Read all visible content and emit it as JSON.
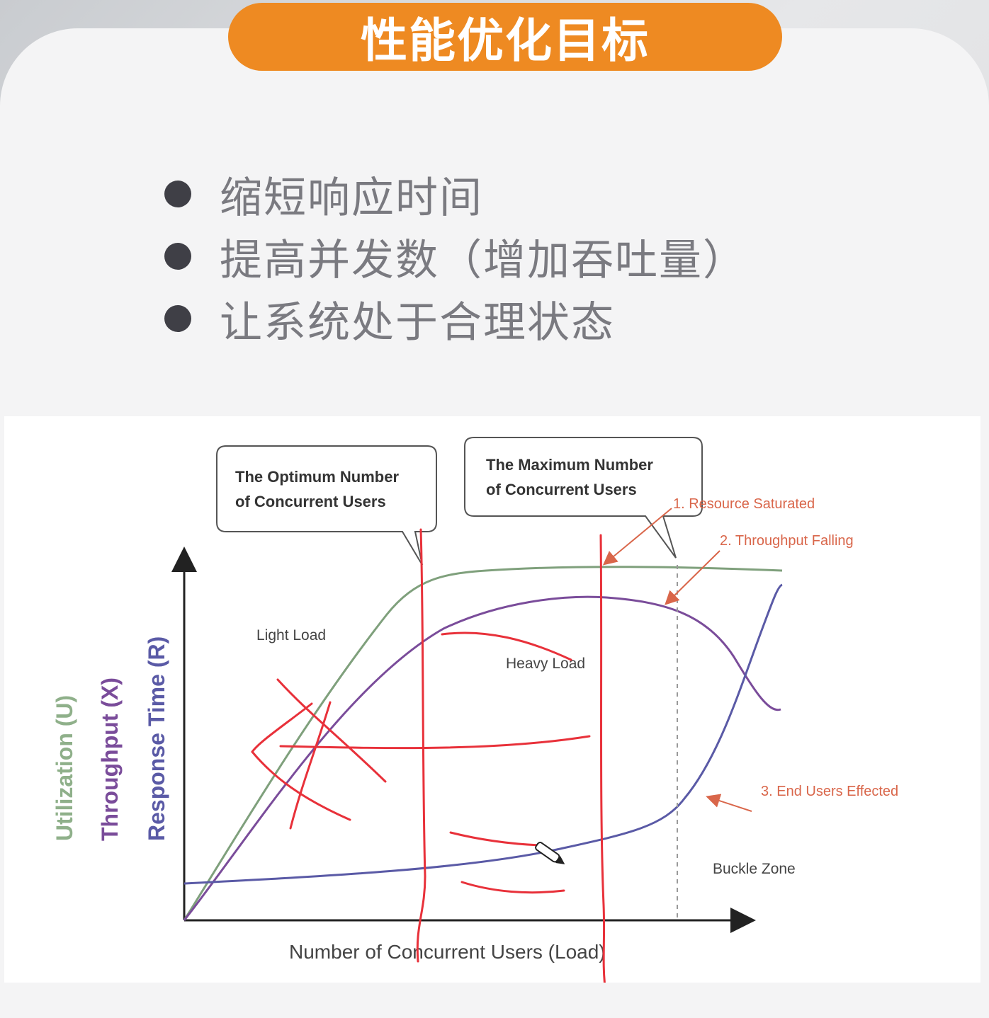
{
  "title": "性能优化目标",
  "bullets": [
    "缩短响应时间",
    "提高并发数（增加吞吐量）",
    "让系统处于合理状态"
  ],
  "diagram": {
    "callout_optimum": [
      "The Optimum Number",
      "of Concurrent Users"
    ],
    "callout_maximum": [
      "The  Maximum  Number",
      "of Concurrent Users"
    ],
    "note_1": "1. Resource Saturated",
    "note_2": "2. Throughput Falling",
    "note_3": "3. End Users Effected",
    "light_load": "Light Load",
    "heavy_load": "Heavy Load",
    "buckle_zone": "Buckle Zone",
    "y_labels": [
      "Utilization (U)",
      "Throughput (X)",
      "Response Time (R)"
    ],
    "x_label": "Number of  Concurrent Users (Load)",
    "colors": {
      "utilization": "#7fa07c",
      "throughput": "#7a4c9a",
      "response_time": "#5a5aa6",
      "annotation": "#e8313a",
      "note": "#d9664a"
    }
  }
}
